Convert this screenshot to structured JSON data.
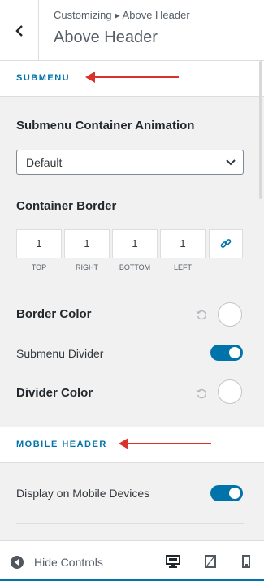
{
  "header": {
    "breadcrumb": "Customizing ▸ Above Header",
    "title": "Above Header"
  },
  "submenu": {
    "section_label": "SUBMENU",
    "animation_label": "Submenu Container Animation",
    "animation_value": "Default",
    "border_label": "Container Border",
    "border_values": [
      "1",
      "1",
      "1",
      "1"
    ],
    "border_sides": [
      "TOP",
      "RIGHT",
      "BOTTOM",
      "LEFT"
    ],
    "border_color_label": "Border Color",
    "divider_label": "Submenu Divider",
    "divider_on": true,
    "divider_color_label": "Divider Color"
  },
  "mobile": {
    "section_label": "MOBILE HEADER",
    "display_label": "Display on Mobile Devices",
    "display_on": true
  },
  "footer": {
    "hide_label": "Hide Controls"
  },
  "colors": {
    "accent": "#0073aa",
    "annotation_arrow": "#d9312b"
  }
}
